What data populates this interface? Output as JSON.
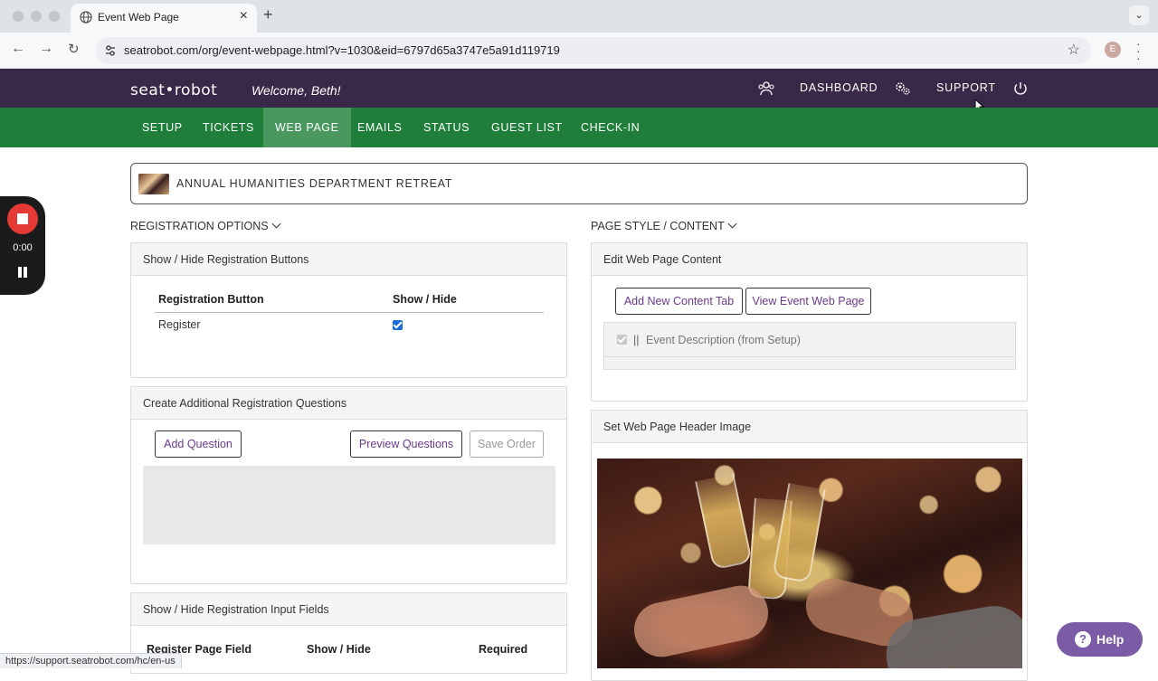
{
  "browser": {
    "tab_title": "Event Web Page",
    "url": "seatrobot.com/org/event-webpage.html?v=1030&eid=6797d65a3747e5a91d119719",
    "profile_initial": "E",
    "status_url": "https://support.seatrobot.com/hc/en-us"
  },
  "header": {
    "logo": "seat•robot",
    "welcome": "Welcome, Beth!",
    "dashboard": "DASHBOARD",
    "support": "SUPPORT"
  },
  "subnav": {
    "items": [
      "SETUP",
      "TICKETS",
      "WEB PAGE",
      "EMAILS",
      "STATUS",
      "GUEST LIST",
      "CHECK-IN"
    ],
    "active": "WEB PAGE"
  },
  "event": {
    "title": "ANNUAL HUMANITIES DEPARTMENT RETREAT"
  },
  "recorder": {
    "time": "0:00"
  },
  "left": {
    "section_label": "REGISTRATION OPTIONS",
    "reg_buttons": {
      "title": "Show / Hide Registration Buttons",
      "col1": "Registration Button",
      "col2": "Show / Hide",
      "rows": [
        {
          "label": "Register",
          "checked": true
        }
      ]
    },
    "questions": {
      "title": "Create Additional Registration Questions",
      "add": "Add Question",
      "preview": "Preview Questions",
      "save": "Save Order"
    },
    "input_fields": {
      "title": "Show / Hide Registration Input Fields",
      "col1": "Register Page Field",
      "col2": "Show / Hide",
      "col3": "Required"
    }
  },
  "right": {
    "section_label": "PAGE STYLE / CONTENT",
    "content": {
      "title": "Edit Web Page Content",
      "add_tab": "Add New Content Tab",
      "view_page": "View Event Web Page",
      "item_handle": "||",
      "item_label": "Event Description (from Setup)"
    },
    "header_image": {
      "title": "Set Web Page Header Image"
    }
  },
  "help": {
    "label": "Help"
  },
  "colors": {
    "header_bg": "#3a2848",
    "subnav_bg": "#1f7f3a",
    "accent": "#6a3a8a",
    "help_bg": "#7b5aa6"
  }
}
